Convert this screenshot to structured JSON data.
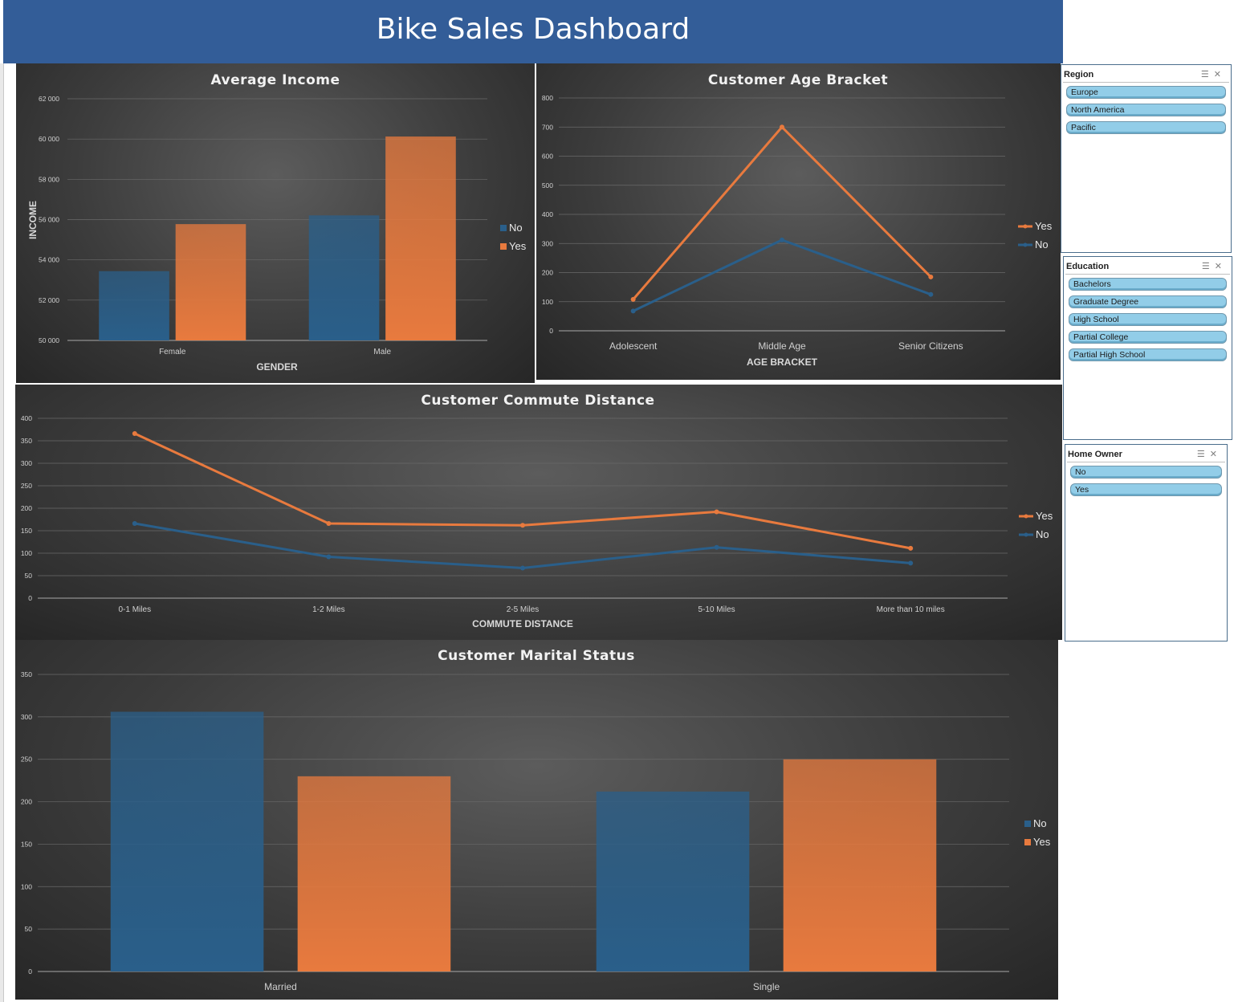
{
  "dashboard": {
    "title": "Bike Sales Dashboard"
  },
  "colors": {
    "no": "#2a5f8a",
    "yes": "#e87a3e",
    "banner": "#335d98",
    "slicer_item": "#92cde8"
  },
  "legend_labels": {
    "no": "No",
    "yes": "Yes"
  },
  "chart_data": [
    {
      "id": "income",
      "type": "bar",
      "title": "Average Income",
      "xlabel": "GENDER",
      "ylabel": "INCOME",
      "categories": [
        "Female",
        "Male"
      ],
      "series": [
        {
          "name": "No",
          "values": [
            53440,
            56208
          ]
        },
        {
          "name": "Yes",
          "values": [
            55775,
            60125
          ]
        }
      ],
      "ylim": [
        50000,
        62000
      ],
      "yticks": [
        "50 000",
        "52 000",
        "54 000",
        "56 000",
        "58 000",
        "60 000",
        "62 000"
      ],
      "legend_order": [
        "No",
        "Yes"
      ],
      "legend_position": "right",
      "grid": true
    },
    {
      "id": "age",
      "type": "line",
      "title": "Customer Age Bracket",
      "xlabel": "AGE BRACKET",
      "ylabel": "",
      "categories": [
        "Adolescent",
        "Middle Age",
        "Senior Citizens"
      ],
      "series": [
        {
          "name": "Yes",
          "values": [
            108,
            700,
            185
          ]
        },
        {
          "name": "No",
          "values": [
            68,
            312,
            125
          ]
        }
      ],
      "ylim": [
        0,
        800
      ],
      "yticks": [
        "0",
        "100",
        "200",
        "300",
        "400",
        "500",
        "600",
        "700",
        "800"
      ],
      "legend_order": [
        "Yes",
        "No"
      ],
      "legend_position": "right",
      "grid": true
    },
    {
      "id": "commute",
      "type": "line",
      "title": "Customer Commute Distance",
      "xlabel": "COMMUTE DISTANCE",
      "ylabel": "",
      "categories": [
        "0-1 Miles",
        "1-2 Miles",
        "2-5 Miles",
        "5-10 Miles",
        "More than 10 miles"
      ],
      "series": [
        {
          "name": "Yes",
          "values": [
            366,
            166,
            162,
            192,
            111
          ]
        },
        {
          "name": "No",
          "values": [
            166,
            92,
            67,
            113,
            78
          ]
        }
      ],
      "ylim": [
        0,
        400
      ],
      "yticks": [
        "0",
        "50",
        "100",
        "150",
        "200",
        "250",
        "300",
        "350",
        "400"
      ],
      "legend_order": [
        "Yes",
        "No"
      ],
      "legend_position": "right",
      "grid": true
    },
    {
      "id": "marital",
      "type": "bar",
      "title": "Customer Marital Status",
      "xlabel": "",
      "ylabel": "",
      "categories": [
        "Married",
        "Single"
      ],
      "series": [
        {
          "name": "No",
          "values": [
            306,
            212
          ]
        },
        {
          "name": "Yes",
          "values": [
            230,
            250
          ]
        }
      ],
      "ylim": [
        0,
        350
      ],
      "yticks": [
        "0",
        "50",
        "100",
        "150",
        "200",
        "250",
        "300",
        "350"
      ],
      "legend_order": [
        "No",
        "Yes"
      ],
      "legend_position": "right",
      "grid": true
    }
  ],
  "slicers": [
    {
      "title": "Region",
      "items": [
        "Europe",
        "North America",
        "Pacific"
      ]
    },
    {
      "title": "Education",
      "items": [
        "Bachelors",
        "Graduate Degree",
        "High School",
        "Partial College",
        "Partial High School"
      ]
    },
    {
      "title": "Home Owner",
      "items": [
        "No",
        "Yes"
      ]
    }
  ]
}
